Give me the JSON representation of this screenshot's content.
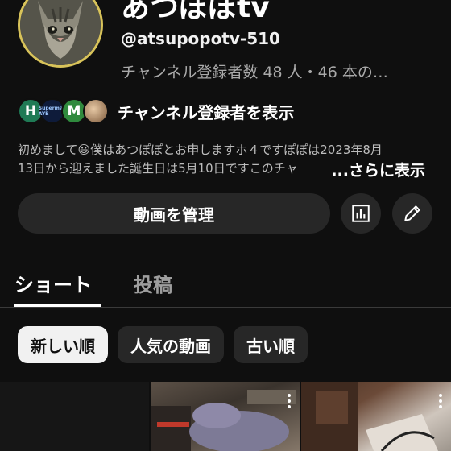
{
  "channel": {
    "name": "あつぽぽtv",
    "handle": "@atsupopotv-510",
    "meta": "チャンネル登録者数 48 人・46 本の…"
  },
  "subscribers": {
    "avatars": [
      "H",
      "Superman AYB",
      "M",
      ""
    ],
    "label": "チャンネル登録者を表示"
  },
  "description": {
    "line1": "初めまして😃僕はあつぽぽとお申しますホ４ですぽぽは2023年8月",
    "line2": "13日から迎えました誕生日は5月10日ですこのチャ",
    "more": "...さらに表示"
  },
  "actions": {
    "manage_label": "動画を管理",
    "stats_icon": "analytics-icon",
    "edit_icon": "pencil-icon"
  },
  "tabs": [
    {
      "label": "ショート",
      "active": true
    },
    {
      "label": "投稿",
      "active": false
    }
  ],
  "chips": [
    {
      "label": "新しい順",
      "selected": true
    },
    {
      "label": "人気の動画",
      "selected": false
    },
    {
      "label": "古い順",
      "selected": false
    }
  ],
  "colors": {
    "background": "#0f0f0f",
    "button": "#272727",
    "secondary_text": "#aaaaaa"
  }
}
